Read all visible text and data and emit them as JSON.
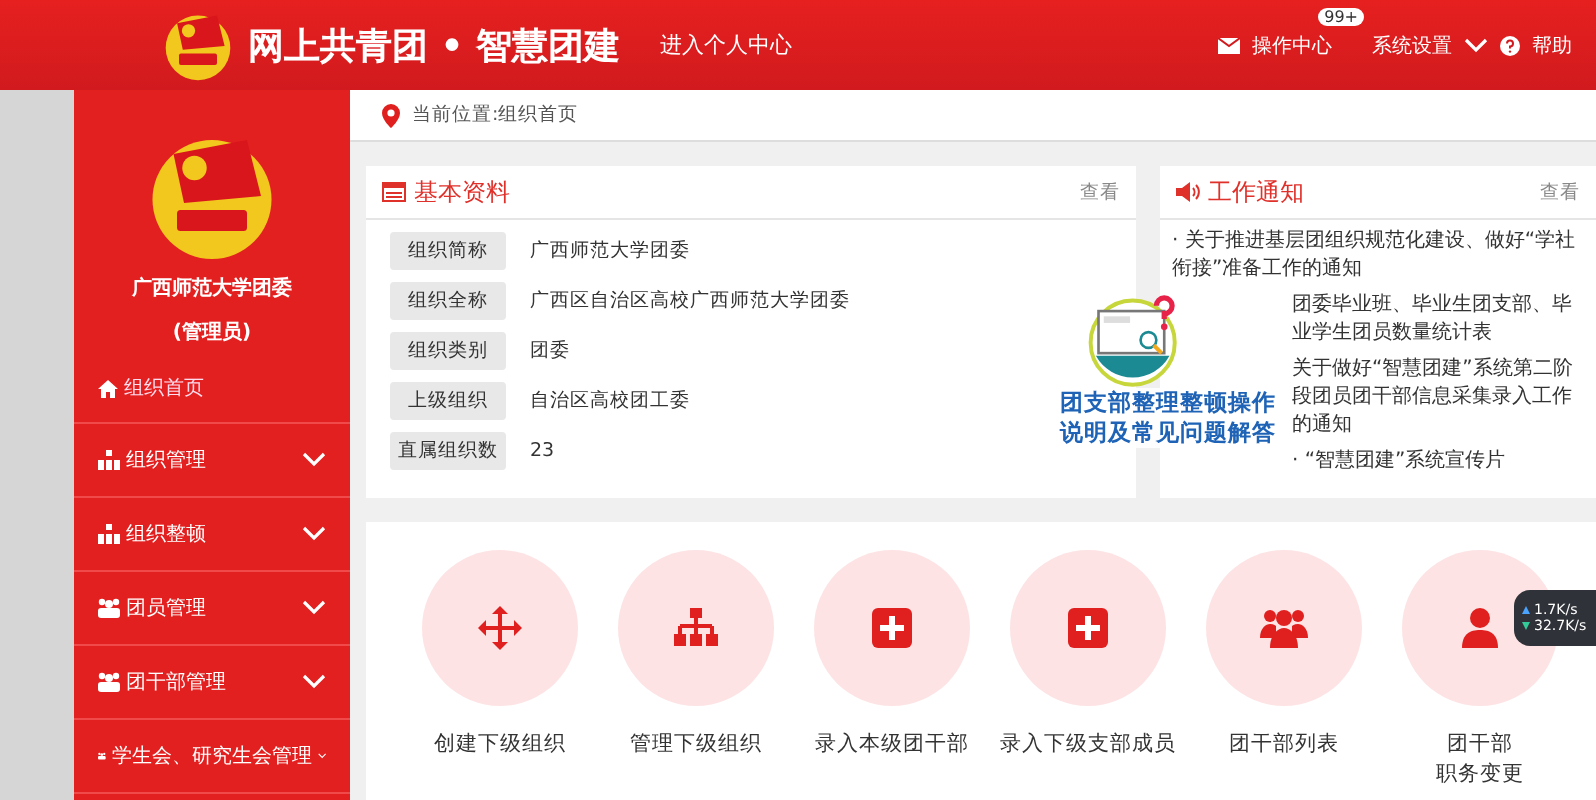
{
  "header": {
    "title": "网上共青团 • 智慧团建",
    "personal_center": "进入个人中心",
    "ops_center": "操作中心",
    "ops_badge": "99+",
    "settings": "系统设置",
    "help": "帮助"
  },
  "sidebar": {
    "org_name": "广西师范大学团委",
    "role": "(管理员)",
    "home": "组织首页",
    "items": [
      {
        "label": "组织管理",
        "kind": "org"
      },
      {
        "label": "组织整顿",
        "kind": "org"
      },
      {
        "label": "团员管理",
        "kind": "people"
      },
      {
        "label": "团干部管理",
        "kind": "people"
      },
      {
        "label": "学生会、研究生会管理",
        "kind": "people"
      }
    ]
  },
  "breadcrumb": "当前位置:组织首页",
  "basic_info": {
    "title": "基本资料",
    "more": "查看",
    "rows": [
      {
        "label": "组织简称",
        "value": "广西师范大学团委"
      },
      {
        "label": "组织全称",
        "value": "广西区自治区高校广西师范大学团委"
      },
      {
        "label": "组织类别",
        "value": "团委"
      },
      {
        "label": "上级组织",
        "value": "自治区高校团工委"
      },
      {
        "label": "直属组织数",
        "value": "23"
      }
    ]
  },
  "notices": {
    "title": "工作通知",
    "more": "查看",
    "items": [
      {
        "text": "· 关于推进基层团组织规范化建设、做好“学社衔接”准备工作的通知"
      },
      {
        "text": "团委毕业班、毕业生团支部、毕业学生团员数量统计表"
      },
      {
        "text": "关于做好“智慧团建”系统第二阶段团员团干部信息采集录入工作的通知"
      },
      {
        "text": "· “智慧团建”系统宣传片"
      }
    ]
  },
  "promo": {
    "line1": "团支部整理整顿操作",
    "line2": "说明及常见问题解答"
  },
  "actions": [
    {
      "lines": [
        "创建下级组织"
      ],
      "kind": "move"
    },
    {
      "lines": [
        "管理下级组织"
      ],
      "kind": "tree"
    },
    {
      "lines": [
        "录入本级团干部"
      ],
      "kind": "plus"
    },
    {
      "lines": [
        "录入下级支部成员"
      ],
      "kind": "plus"
    },
    {
      "lines": [
        "团干部列表"
      ],
      "kind": "group"
    },
    {
      "lines": [
        "团干部",
        "职务变更"
      ],
      "kind": "person"
    }
  ],
  "net_speed": {
    "up": "1.7K/s",
    "down": "32.7K/s"
  }
}
